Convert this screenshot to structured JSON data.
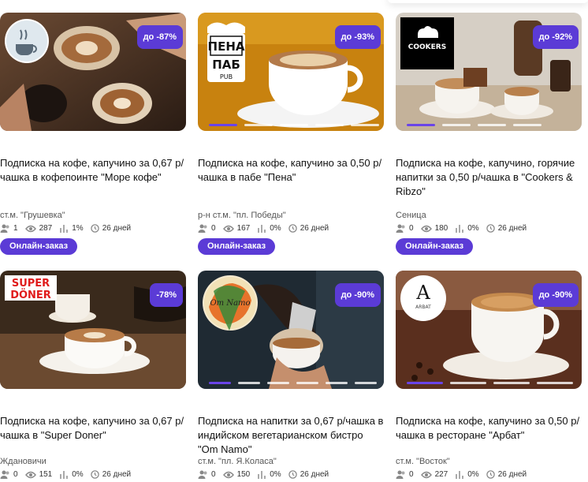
{
  "order_label": "Онлайн-заказ",
  "colors": {
    "accent": "#5b3bd6"
  },
  "cards": [
    {
      "badge": "до -87%",
      "title": "Подписка на кофе, капучино за 0,67 р/чашка в кофепоинте \"Море кофе\"",
      "location": "ст.м. \"Грушевка\"",
      "stats": {
        "buyers": "1",
        "views": "287",
        "percent": "1%",
        "days": "26 дней"
      }
    },
    {
      "badge": "до -93%",
      "logo_top": "ПЕНА",
      "logo_mid": "ПАБ",
      "logo_bot": "PUB",
      "title": "Подписка на кофе, капучино за 0,50 р/чашка в пабе \"Пена\"",
      "location": "р-н ст.м. \"пл. Победы\"",
      "stats": {
        "buyers": "0",
        "views": "167",
        "percent": "0%",
        "days": "26 дней"
      }
    },
    {
      "badge": "до -92%",
      "logo_text": "COOKERS",
      "title": "Подписка на кофе, капучино, горячие напитки за 0,50 р/чашка в \"Cookers & Ribzo\"",
      "location": "Сеница",
      "stats": {
        "buyers": "0",
        "views": "180",
        "percent": "0%",
        "days": "26 дней"
      }
    },
    {
      "badge": "-78%",
      "logo_top": "SUPER",
      "logo_bot": "DÖNER",
      "title": "Подписка на кофе, капучино за 0,67 р/чашка в \"Super Doner\"",
      "location": "Ждановичи",
      "stats": {
        "buyers": "0",
        "views": "151",
        "percent": "0%",
        "days": "26 дней"
      }
    },
    {
      "badge": "до -90%",
      "logo_text": "Om Namo",
      "title": "Подписка на напитки за 0,67 р/чашка в индийском вегетарианском бистро \"Om Namo\"",
      "location": "ст.м. \"пл. Я.Коласа\"",
      "stats": {
        "buyers": "0",
        "views": "150",
        "percent": "0%",
        "days": "26 дней"
      }
    },
    {
      "badge": "до -90%",
      "logo_big": "A",
      "logo_text": "ARBAT",
      "title": "Подписка на кофе, капучино за 0,50 р/чашка в ресторане \"Арбат\"",
      "location": "ст.м. \"Восток\"",
      "stats": {
        "buyers": "0",
        "views": "227",
        "percent": "0%",
        "days": "26 дней"
      }
    }
  ]
}
